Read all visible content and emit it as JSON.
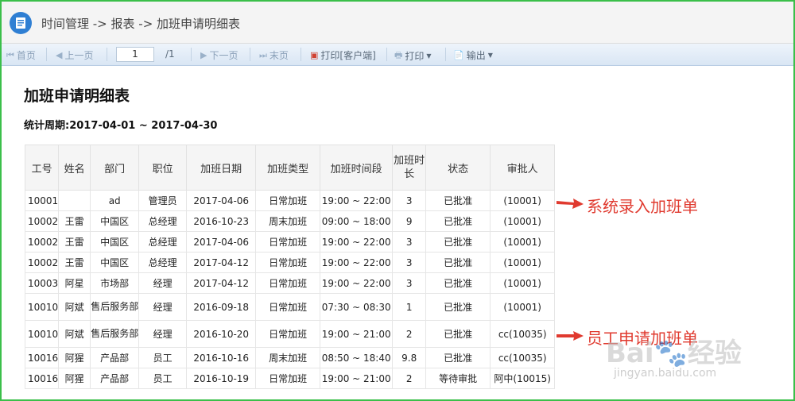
{
  "breadcrumb": "时间管理 -> 报表 -> 加班申请明细表",
  "toolbar": {
    "first": "首页",
    "prev": "上一页",
    "page": "1",
    "total": "/1",
    "next": "下一页",
    "last": "末页",
    "print_client": "打印[客户端]",
    "print": "打印",
    "export": "输出"
  },
  "report": {
    "title": "加班申请明细表",
    "period": "统计周期:2017-04-01 ~ 2017-04-30",
    "headers": [
      "工号",
      "姓名",
      "部门",
      "职位",
      "加班日期",
      "加班类型",
      "加班时间段",
      "加班时长",
      "状态",
      "审批人"
    ],
    "rows": [
      [
        "10001",
        "",
        "ad",
        "管理员",
        "2017-04-06",
        "日常加班",
        "19:00 ~ 22:00",
        "3",
        "已批准",
        "(10001)"
      ],
      [
        "10002",
        "王雷",
        "中国区",
        "总经理",
        "2016-10-23",
        "周末加班",
        "09:00 ~ 18:00",
        "9",
        "已批准",
        "(10001)"
      ],
      [
        "10002",
        "王雷",
        "中国区",
        "总经理",
        "2017-04-06",
        "日常加班",
        "19:00 ~ 22:00",
        "3",
        "已批准",
        "(10001)"
      ],
      [
        "10002",
        "王雷",
        "中国区",
        "总经理",
        "2017-04-12",
        "日常加班",
        "19:00 ~ 22:00",
        "3",
        "已批准",
        "(10001)"
      ],
      [
        "10003",
        "阿星",
        "市场部",
        "经理",
        "2017-04-12",
        "日常加班",
        "19:00 ~ 22:00",
        "3",
        "已批准",
        "(10001)"
      ],
      [
        "10010",
        "阿斌",
        "售后服务部",
        "经理",
        "2016-09-18",
        "日常加班",
        "07:30 ~ 08:30",
        "1",
        "已批准",
        "(10001)"
      ],
      [
        "10010",
        "阿斌",
        "售后服务部",
        "经理",
        "2016-10-20",
        "日常加班",
        "19:00 ~ 21:00",
        "2",
        "已批准",
        "cc(10035)"
      ],
      [
        "10016",
        "阿猩",
        "产品部",
        "员工",
        "2016-10-16",
        "周末加班",
        "08:50 ~ 18:40",
        "9.8",
        "已批准",
        "cc(10035)"
      ],
      [
        "10016",
        "阿猩",
        "产品部",
        "员工",
        "2016-10-19",
        "日常加班",
        "19:00 ~ 21:00",
        "2",
        "等待审批",
        "阿中(10015)"
      ]
    ]
  },
  "annotations": {
    "system": "系统录入加班单",
    "employee": "员工申请加班单",
    "color": "#e03a2f"
  },
  "watermark": {
    "brand": "Bai经验",
    "url": "jingyan.baidu.com"
  }
}
